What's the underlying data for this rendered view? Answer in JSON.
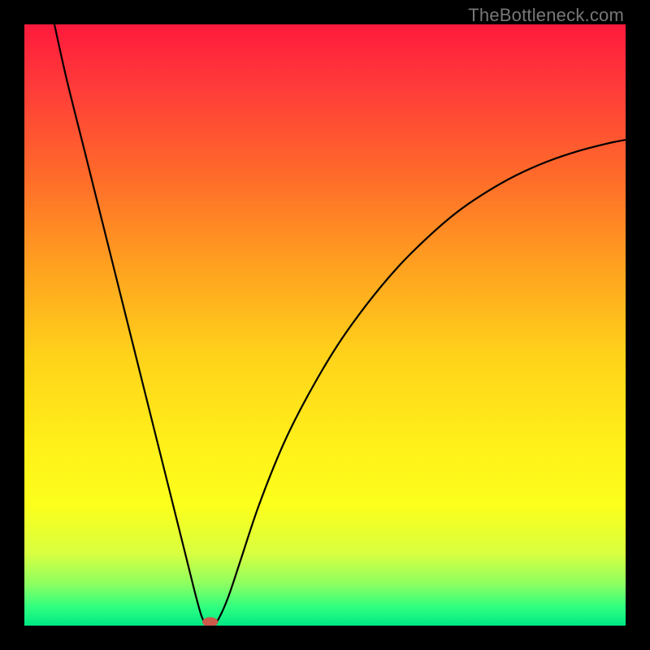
{
  "watermark": "TheBottleneck.com",
  "chart_data": {
    "type": "line",
    "title": "",
    "xlabel": "",
    "ylabel": "",
    "xlim": [
      0,
      100
    ],
    "ylim": [
      0,
      100
    ],
    "background": {
      "type": "vertical-gradient",
      "stops": [
        {
          "offset": 0.0,
          "color": "#ff1a3c"
        },
        {
          "offset": 0.1,
          "color": "#ff3a3a"
        },
        {
          "offset": 0.25,
          "color": "#ff6a2a"
        },
        {
          "offset": 0.4,
          "color": "#ffa020"
        },
        {
          "offset": 0.55,
          "color": "#ffd21a"
        },
        {
          "offset": 0.7,
          "color": "#fff01a"
        },
        {
          "offset": 0.8,
          "color": "#fcff1c"
        },
        {
          "offset": 0.88,
          "color": "#d8ff40"
        },
        {
          "offset": 0.93,
          "color": "#8eff60"
        },
        {
          "offset": 0.97,
          "color": "#2eff80"
        },
        {
          "offset": 1.0,
          "color": "#00e884"
        }
      ]
    },
    "series": [
      {
        "name": "curve",
        "color": "#000000",
        "points": [
          {
            "x": 5.0,
            "y": 100.0
          },
          {
            "x": 7.0,
            "y": 91.0
          },
          {
            "x": 10.0,
            "y": 79.0
          },
          {
            "x": 13.0,
            "y": 67.0
          },
          {
            "x": 16.0,
            "y": 55.0
          },
          {
            "x": 19.0,
            "y": 43.0
          },
          {
            "x": 22.0,
            "y": 31.0
          },
          {
            "x": 25.0,
            "y": 19.0
          },
          {
            "x": 27.0,
            "y": 11.0
          },
          {
            "x": 28.5,
            "y": 5.0
          },
          {
            "x": 29.5,
            "y": 1.5
          },
          {
            "x": 30.3,
            "y": 0.2
          },
          {
            "x": 31.5,
            "y": 0.2
          },
          {
            "x": 32.5,
            "y": 1.5
          },
          {
            "x": 34.0,
            "y": 5.0
          },
          {
            "x": 36.0,
            "y": 11.0
          },
          {
            "x": 39.0,
            "y": 20.0
          },
          {
            "x": 43.0,
            "y": 30.0
          },
          {
            "x": 47.0,
            "y": 38.0
          },
          {
            "x": 52.0,
            "y": 46.5
          },
          {
            "x": 57.0,
            "y": 53.5
          },
          {
            "x": 62.0,
            "y": 59.5
          },
          {
            "x": 67.0,
            "y": 64.5
          },
          {
            "x": 72.0,
            "y": 68.8
          },
          {
            "x": 77.0,
            "y": 72.2
          },
          {
            "x": 82.0,
            "y": 75.0
          },
          {
            "x": 87.0,
            "y": 77.2
          },
          {
            "x": 92.0,
            "y": 78.9
          },
          {
            "x": 97.0,
            "y": 80.2
          },
          {
            "x": 100.0,
            "y": 80.8
          }
        ]
      }
    ],
    "marker": {
      "x": 30.9,
      "y": 0.6,
      "rx": 1.3,
      "ry": 0.8,
      "color": "#cc5a4a"
    }
  }
}
